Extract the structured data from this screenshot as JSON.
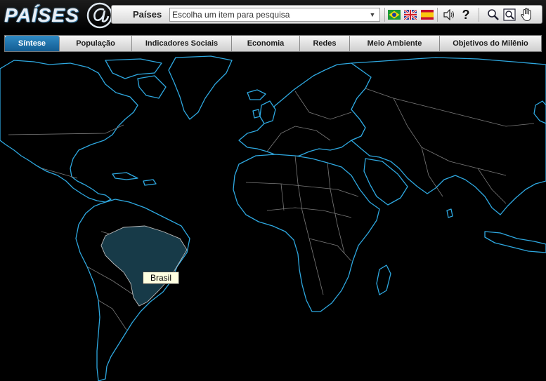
{
  "app": {
    "logo_text": "PAÍSES",
    "logo_at": "@"
  },
  "search": {
    "label": "Países",
    "placeholder": "Escolha um item para pesquisa"
  },
  "toolbar": {
    "languages": [
      "portuguese-brazil-flag",
      "english-uk-flag",
      "spanish-flag"
    ],
    "icons": [
      "speaker-icon",
      "help-icon",
      "zoom-in-icon",
      "zoom-area-icon",
      "pan-hand-icon"
    ],
    "help_label": "?"
  },
  "tabs": [
    {
      "label": "Síntese",
      "active": true
    },
    {
      "label": "População",
      "active": false
    },
    {
      "label": "Indicadores Sociais",
      "active": false
    },
    {
      "label": "Economia",
      "active": false
    },
    {
      "label": "Redes",
      "active": false
    },
    {
      "label": "Meio Ambiente",
      "active": false
    },
    {
      "label": "Objetivos do Milênio",
      "active": false
    }
  ],
  "map": {
    "highlighted_country": "Brasil",
    "tooltip": "Brasil",
    "colors": {
      "ocean": "#000000",
      "coastline": "#2ea8e0",
      "borders": "#7a7a7a",
      "highlight": "#173a48"
    }
  }
}
